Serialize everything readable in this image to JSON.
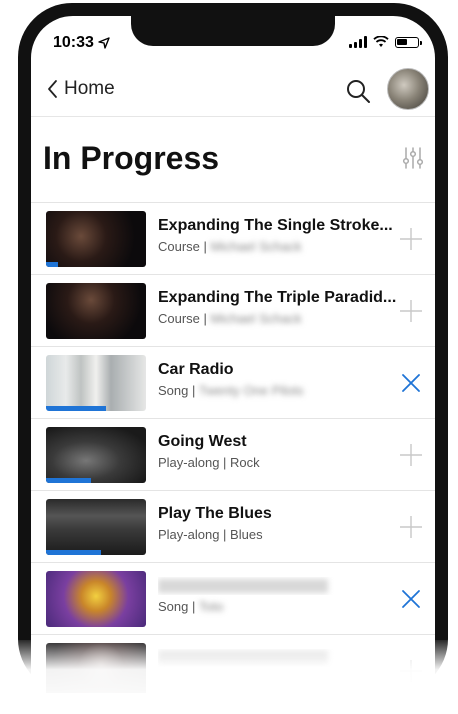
{
  "status": {
    "time": "10:33"
  },
  "nav": {
    "back_label": "Home"
  },
  "page": {
    "title": "In Progress"
  },
  "colors": {
    "accent": "#1f74d6",
    "thumb_progress": "#1f74d6"
  },
  "items": [
    {
      "title": "Expanding The Single Stroke...",
      "type": "Course",
      "detail": "Michael Schack",
      "action": "plus",
      "progress": 0.12
    },
    {
      "title": "Expanding The Triple Paradid...",
      "type": "Course",
      "detail": "Michael Schack",
      "action": "plus",
      "progress": 0.0
    },
    {
      "title": "Car Radio",
      "type": "Song",
      "detail": "Twenty One Pilots",
      "action": "close",
      "progress": 0.6
    },
    {
      "title": "Going West",
      "type": "Play-along",
      "detail": "Rock",
      "action": "plus",
      "progress": 0.45
    },
    {
      "title": "Play The Blues",
      "type": "Play-along",
      "detail": "Blues",
      "action": "plus",
      "progress": 0.55
    },
    {
      "title": "",
      "type": "Song",
      "detail": "Toto",
      "action": "close",
      "progress": 0.0
    },
    {
      "title": "",
      "type": "",
      "detail": "",
      "action": "plus",
      "progress": 0.0
    }
  ]
}
